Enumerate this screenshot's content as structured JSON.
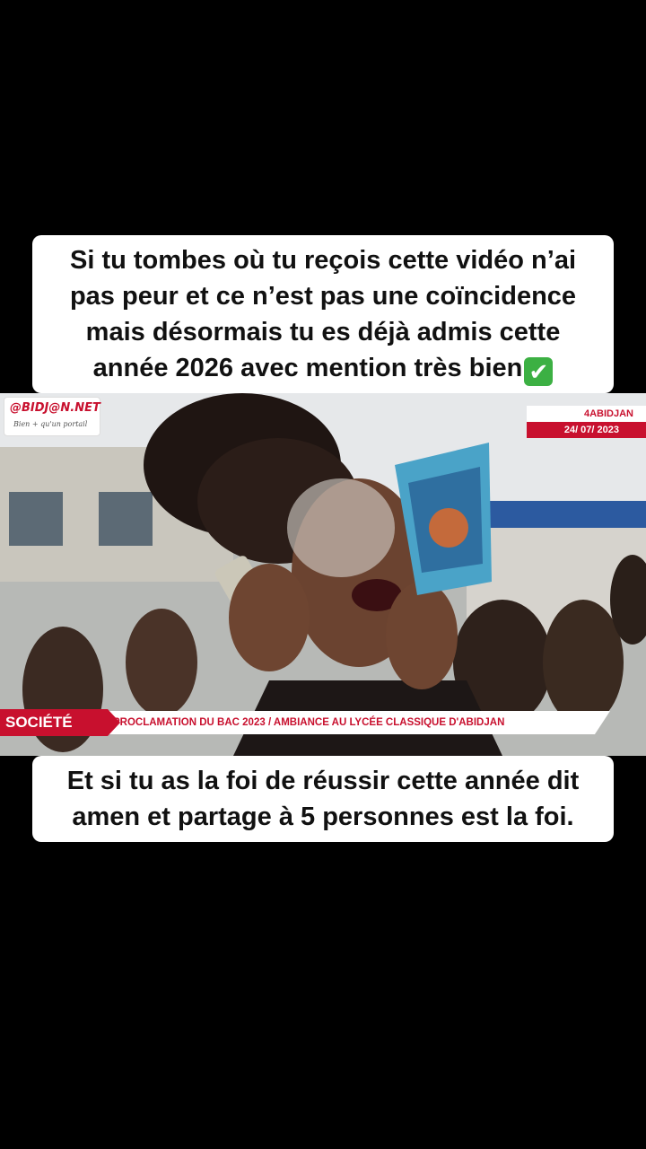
{
  "captions": {
    "top": {
      "lines": [
        "Si tu tombes où tu reçois cette vidéo n’ai",
        "pas peur et ce n’est pas une coïncidence",
        "mais désormais tu es déjà admis cette",
        "année 2026 avec mention très bien"
      ],
      "emoji": "✔"
    },
    "bottom": {
      "lines": [
        "Et si tu as la foi de réussir cette année dit",
        "amen et partage à 5 personnes est la foi."
      ]
    }
  },
  "video": {
    "logo": {
      "name": "@BIDJ@N.NET",
      "tagline": "Bien + qu'un portail"
    },
    "location": "4ABIDJAN",
    "date": "24/ 07/ 2023",
    "lower_third": {
      "category": "SOCIÉTÉ",
      "headline": "PROCLAMATION DU BAC 2023 / AMBIANCE AU LYCÉE CLASSIQUE D'ABIDJAN"
    }
  },
  "colors": {
    "accent": "#c8102e",
    "check": "#3cb043"
  }
}
